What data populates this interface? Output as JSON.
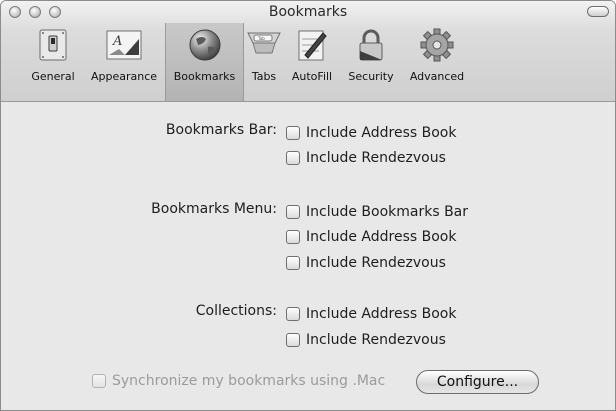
{
  "window": {
    "title": "Bookmarks"
  },
  "toolbar": {
    "items": [
      {
        "label": "General",
        "icon": "general-switch-icon",
        "selected": false
      },
      {
        "label": "Appearance",
        "icon": "appearance-font-icon",
        "selected": false
      },
      {
        "label": "Bookmarks",
        "icon": "globe-icon",
        "selected": true
      },
      {
        "label": "Tabs",
        "icon": "tabs-icon",
        "selected": false
      },
      {
        "label": "AutoFill",
        "icon": "autofill-pen-icon",
        "selected": false
      },
      {
        "label": "Security",
        "icon": "lock-icon",
        "selected": false
      },
      {
        "label": "Advanced",
        "icon": "gear-icon",
        "selected": false
      }
    ]
  },
  "sections": {
    "bookmarks_bar": {
      "label": "Bookmarks Bar:",
      "options": [
        "Include Address Book",
        "Include Rendezvous"
      ]
    },
    "bookmarks_menu": {
      "label": "Bookmarks Menu:",
      "options": [
        "Include Bookmarks Bar",
        "Include Address Book",
        "Include Rendezvous"
      ]
    },
    "collections": {
      "label": "Collections:",
      "options": [
        "Include Address Book",
        "Include Rendezvous"
      ]
    }
  },
  "sync": {
    "label": "Synchronize my bookmarks using .Mac",
    "enabled": false,
    "configure_button": "Configure..."
  }
}
